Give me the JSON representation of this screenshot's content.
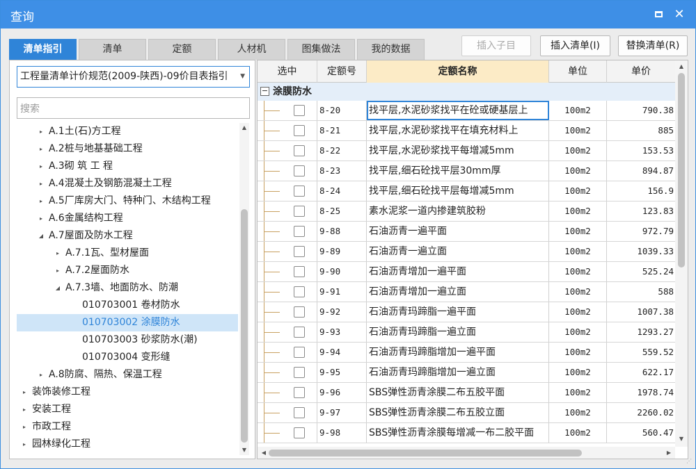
{
  "window": {
    "title": "查询"
  },
  "tabs": [
    {
      "label": "清单指引",
      "active": true
    },
    {
      "label": "清单",
      "active": false
    },
    {
      "label": "定额",
      "active": false
    },
    {
      "label": "人材机",
      "active": false
    },
    {
      "label": "图集做法",
      "active": false
    },
    {
      "label": "我的数据",
      "active": false
    }
  ],
  "actions": {
    "insert_child": "插入子目",
    "insert_list": "插入清单(I)",
    "replace_list": "替换清单(R)"
  },
  "left": {
    "combo_value": "工程量清单计价规范(2009-陕西)-09价目表指引",
    "search_placeholder": "搜索",
    "tree": [
      {
        "label": "A.1土(石)方工程",
        "toggle": "▸",
        "selected": false
      },
      {
        "label": "A.2桩与地基基础工程",
        "toggle": "▸",
        "selected": false
      },
      {
        "label": "A.3砌 筑 工 程",
        "toggle": "▸",
        "selected": false
      },
      {
        "label": "A.4混凝土及钢筋混凝土工程",
        "toggle": "▸",
        "selected": false
      },
      {
        "label": "A.5厂库房大门、特种门、木结构工程",
        "toggle": "▸",
        "selected": false
      },
      {
        "label": "A.6金属结构工程",
        "toggle": "▸",
        "selected": false
      },
      {
        "label": "A.7屋面及防水工程",
        "toggle": "◢",
        "selected": false
      },
      {
        "label": "A.7.1瓦、型材屋面",
        "toggle": "▸",
        "selected": false
      },
      {
        "label": "A.7.2屋面防水",
        "toggle": "▸",
        "selected": false
      },
      {
        "label": "A.7.3墙、地面防水、防潮",
        "toggle": "◢",
        "selected": false
      },
      {
        "label": "010703001  卷材防水",
        "toggle": "",
        "selected": false
      },
      {
        "label": "010703002  涂膜防水",
        "toggle": "",
        "selected": true
      },
      {
        "label": "010703003  砂浆防水(潮)",
        "toggle": "",
        "selected": false
      },
      {
        "label": "010703004  变形缝",
        "toggle": "",
        "selected": false
      },
      {
        "label": "A.8防腐、隔热、保温工程",
        "toggle": "▸",
        "selected": false
      },
      {
        "label": "装饰装修工程",
        "toggle": "▸",
        "selected": false
      },
      {
        "label": "安装工程",
        "toggle": "▸",
        "selected": false
      },
      {
        "label": "市政工程",
        "toggle": "▸",
        "selected": false
      },
      {
        "label": "园林绿化工程",
        "toggle": "▸",
        "selected": false
      }
    ]
  },
  "grid": {
    "headers": {
      "select": "选中",
      "code": "定额号",
      "name": "定额名称",
      "unit": "单位",
      "price": "单价"
    },
    "group": {
      "toggle": "−",
      "label": "涂膜防水"
    },
    "rows": [
      {
        "code": "8-20",
        "name": "找平层,水泥砂浆找平在砼或硬基层上",
        "unit": "100m2",
        "price": "790.38"
      },
      {
        "code": "8-21",
        "name": "找平层,水泥砂浆找平在填充材料上",
        "unit": "100m2",
        "price": "885"
      },
      {
        "code": "8-22",
        "name": "找平层,水泥砂浆找平每增减5mm",
        "unit": "100m2",
        "price": "153.53"
      },
      {
        "code": "8-23",
        "name": "找平层,细石砼找平层30mm厚",
        "unit": "100m2",
        "price": "894.87"
      },
      {
        "code": "8-24",
        "name": "找平层,细石砼找平层每增减5mm",
        "unit": "100m2",
        "price": "156.9"
      },
      {
        "code": "8-25",
        "name": "素水泥浆一道内掺建筑胶粉",
        "unit": "100m2",
        "price": "123.83"
      },
      {
        "code": "9-88",
        "name": "石油沥青一遍平面",
        "unit": "100m2",
        "price": "972.79"
      },
      {
        "code": "9-89",
        "name": "石油沥青一遍立面",
        "unit": "100m2",
        "price": "1039.33"
      },
      {
        "code": "9-90",
        "name": "石油沥青增加一遍平面",
        "unit": "100m2",
        "price": "525.24"
      },
      {
        "code": "9-91",
        "name": "石油沥青增加一遍立面",
        "unit": "100m2",
        "price": "588"
      },
      {
        "code": "9-92",
        "name": "石油沥青玛蹄脂一遍平面",
        "unit": "100m2",
        "price": "1007.38"
      },
      {
        "code": "9-93",
        "name": "石油沥青玛蹄脂一遍立面",
        "unit": "100m2",
        "price": "1293.27"
      },
      {
        "code": "9-94",
        "name": "石油沥青玛蹄脂增加一遍平面",
        "unit": "100m2",
        "price": "559.52"
      },
      {
        "code": "9-95",
        "name": "石油沥青玛蹄脂增加一遍立面",
        "unit": "100m2",
        "price": "622.17"
      },
      {
        "code": "9-96",
        "name": "SBS弹性沥青涂膜二布五胶平面",
        "unit": "100m2",
        "price": "1978.74"
      },
      {
        "code": "9-97",
        "name": "SBS弹性沥青涂膜二布五胶立面",
        "unit": "100m2",
        "price": "2260.02"
      },
      {
        "code": "9-98",
        "name": "SBS弹性沥青涂膜每增减一布二胶平面",
        "unit": "100m2",
        "price": "560.47"
      }
    ]
  },
  "colors": {
    "accent": "#2f84d8",
    "titlebar": "#3e8fe6",
    "header_highlight": "#fcebc6",
    "selected_row": "#cfe5f8"
  }
}
